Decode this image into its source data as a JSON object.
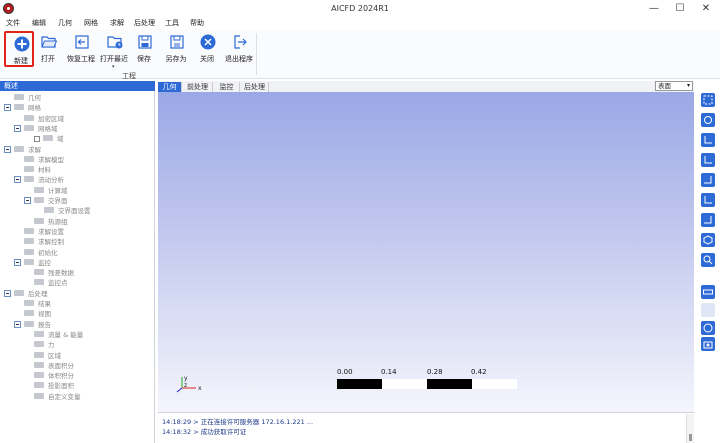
{
  "window": {
    "title": "AICFD 2024R1",
    "minimize": "—",
    "maximize": "☐",
    "close": "✕"
  },
  "menu": [
    "文件",
    "编辑",
    "几何",
    "网格",
    "求解",
    "后处理",
    "工具",
    "帮助"
  ],
  "ribbon": {
    "buttons": [
      {
        "label": "新建",
        "icon": "plus-circle-icon",
        "selected": true
      },
      {
        "label": "打开",
        "icon": "folder-open-icon"
      },
      {
        "label": "恢复工程",
        "icon": "restore-project-icon"
      },
      {
        "label": "打开最近",
        "icon": "recent-folder-icon"
      },
      {
        "label": "保存",
        "icon": "save-icon"
      },
      {
        "label": "另存为",
        "icon": "save-as-icon"
      },
      {
        "label": "关闭",
        "icon": "close-circle-icon"
      },
      {
        "label": "退出程序",
        "icon": "exit-icon"
      }
    ],
    "group_label": "工程"
  },
  "tree": {
    "header": "概述",
    "items": [
      {
        "label": "几何",
        "level": 1,
        "toggle": false
      },
      {
        "label": "网格",
        "level": 1,
        "toggle": true
      },
      {
        "label": "加密区域",
        "level": 2,
        "toggle": false
      },
      {
        "label": "网格域",
        "level": 2,
        "toggle": true
      },
      {
        "label": "域",
        "level": 3,
        "toggle": false,
        "checkbox": true
      },
      {
        "label": "求解",
        "level": 1,
        "toggle": true
      },
      {
        "label": "求解模型",
        "level": 2,
        "toggle": false
      },
      {
        "label": "材料",
        "level": 2,
        "toggle": false
      },
      {
        "label": "流动分析",
        "level": 2,
        "toggle": true
      },
      {
        "label": "计算域",
        "level": 3,
        "toggle": false
      },
      {
        "label": "交界面",
        "level": 3,
        "toggle": true
      },
      {
        "label": "交界面设置",
        "level": 4,
        "toggle": false
      },
      {
        "label": "热源组",
        "level": 3,
        "toggle": false
      },
      {
        "label": "求解设置",
        "level": 2,
        "toggle": false
      },
      {
        "label": "求解控制",
        "level": 2,
        "toggle": false
      },
      {
        "label": "初始化",
        "level": 2,
        "toggle": false
      },
      {
        "label": "监控",
        "level": 2,
        "toggle": true
      },
      {
        "label": "残差数据",
        "level": 3,
        "toggle": false
      },
      {
        "label": "监控点",
        "level": 3,
        "toggle": false
      },
      {
        "label": "后处理",
        "level": 1,
        "toggle": true
      },
      {
        "label": "结果",
        "level": 2,
        "toggle": false
      },
      {
        "label": "视图",
        "level": 2,
        "toggle": false
      },
      {
        "label": "报告",
        "level": 2,
        "toggle": true
      },
      {
        "label": "流量 & 能量",
        "level": 3,
        "toggle": false
      },
      {
        "label": "力",
        "level": 3,
        "toggle": false
      },
      {
        "label": "区域",
        "level": 3,
        "toggle": false
      },
      {
        "label": "表面积分",
        "level": 3,
        "toggle": false
      },
      {
        "label": "体积积分",
        "level": 3,
        "toggle": false
      },
      {
        "label": "投影面积",
        "level": 3,
        "toggle": false
      },
      {
        "label": "自定义变量",
        "level": 3,
        "toggle": false
      }
    ]
  },
  "tabs": [
    "几何",
    "前处理",
    "监控",
    "后处理"
  ],
  "active_tab": "几何",
  "view_select": "表面",
  "scale_bar": [
    "0.00",
    "0.14",
    "0.28",
    "0.42"
  ],
  "axes": {
    "x": "x",
    "y": "y",
    "z": "z"
  },
  "console": [
    "14:18:29 > 正在连接许可服务器 172.16.1.221 ...",
    "14:18:32 > 成功获取许可证"
  ],
  "colors": {
    "accent": "#2d6ad6",
    "selected_border": "#e2231a"
  }
}
